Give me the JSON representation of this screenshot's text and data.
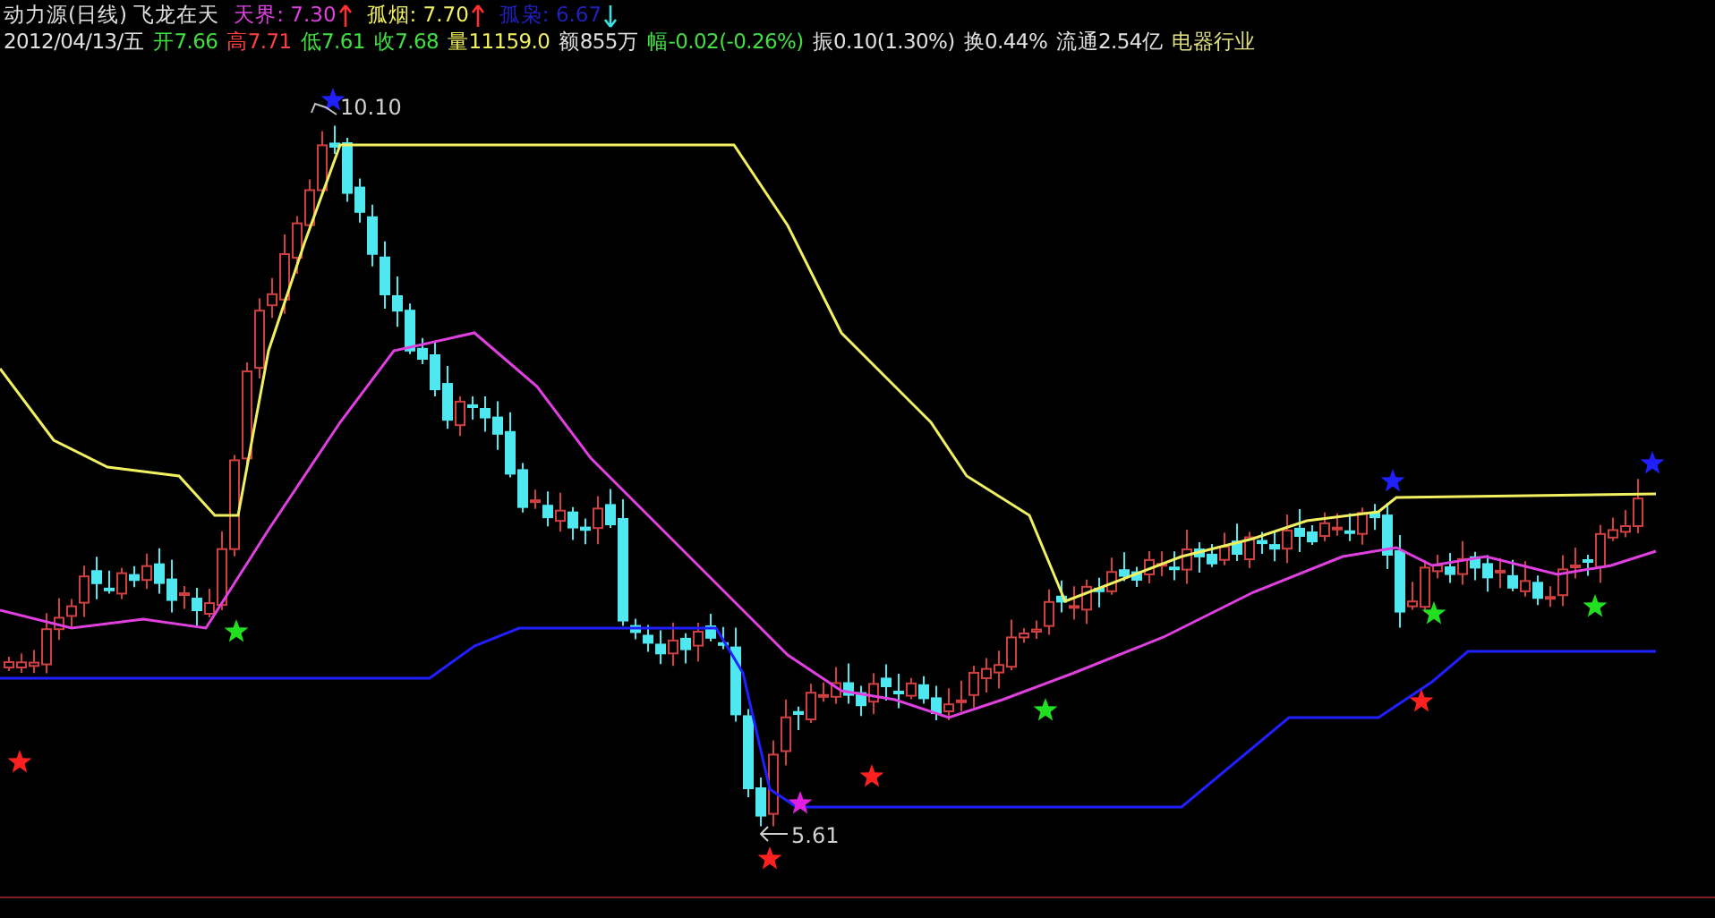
{
  "header": {
    "title": "动力源(日线) 飞龙在天",
    "indicators": [
      {
        "label": "天界: 7.30",
        "color": "#e040e0",
        "rising": true
      },
      {
        "label": "孤烟: 7.70",
        "color": "#f0f060",
        "rising": true
      },
      {
        "label": "孤枭: 6.67",
        "color": "#2020c0",
        "rising": false
      }
    ]
  },
  "quote": [
    {
      "text": "2012/04/13/五",
      "color": "#e0e0e0"
    },
    {
      "text": "开7.66",
      "color": "#40e040"
    },
    {
      "text": "高7.71",
      "color": "#ff4040"
    },
    {
      "text": "低7.61",
      "color": "#40e040"
    },
    {
      "text": "收7.68",
      "color": "#40e040"
    },
    {
      "text": "量11159.0",
      "color": "#f0f060"
    },
    {
      "text": "额855万",
      "color": "#e0e0e0"
    },
    {
      "text": "幅-0.02(-0.26%)",
      "color": "#40e040"
    },
    {
      "text": "振0.10(1.30%)",
      "color": "#e0e0e0"
    },
    {
      "text": "换0.44%",
      "color": "#e0e0e0"
    },
    {
      "text": "流通2.54亿",
      "color": "#e0e0e0"
    },
    {
      "text": "电器行业",
      "color": "#e0e080"
    }
  ],
  "chart": {
    "high_label": "10.10",
    "low_label": "5.61"
  }
}
